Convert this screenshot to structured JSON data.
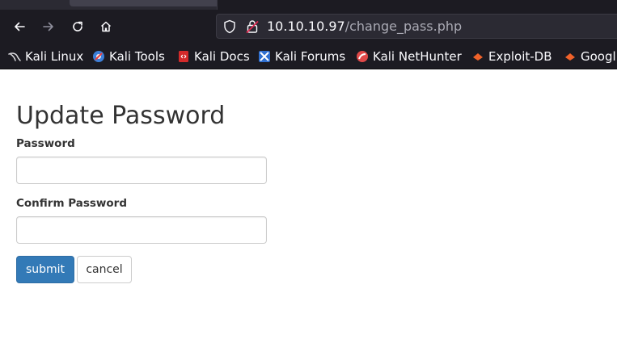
{
  "browser": {
    "url_host": "10.10.10.97",
    "url_path": "/change_pass.php",
    "icons": {
      "back": "back-arrow-icon",
      "forward": "forward-arrow-icon",
      "reload": "reload-icon",
      "home": "home-icon",
      "shield": "shield-icon",
      "lock": "lock-icon"
    },
    "bookmarks": [
      {
        "label": "Kali Linux",
        "icon": "kali-dragon-icon"
      },
      {
        "label": "Kali Tools",
        "icon": "kali-tools-icon"
      },
      {
        "label": "Kali Docs",
        "icon": "kali-docs-icon"
      },
      {
        "label": "Kali Forums",
        "icon": "kali-forums-icon"
      },
      {
        "label": "Kali NetHunter",
        "icon": "kali-nethunter-icon"
      },
      {
        "label": "Exploit-DB",
        "icon": "exploit-db-icon"
      },
      {
        "label": "Googl",
        "icon": "google-hacking-db-icon"
      }
    ]
  },
  "form": {
    "title": "Update Password",
    "password_label": "Password",
    "password_value": "",
    "confirm_label": "Confirm Password",
    "confirm_value": "",
    "submit_label": "submit",
    "cancel_label": "cancel"
  },
  "colors": {
    "chrome_bg": "#1c1b22",
    "urlbar_bg": "#2b2a33",
    "primary": "#337ab7",
    "text": "#333333"
  }
}
